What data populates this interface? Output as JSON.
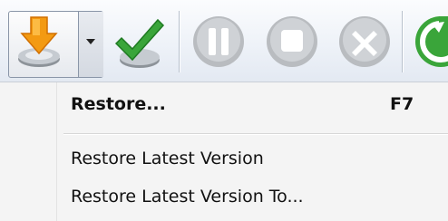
{
  "toolbar": {
    "buttons": [
      {
        "name": "restore",
        "icon": "restore-download-icon",
        "has_dropdown": true
      },
      {
        "name": "verify",
        "icon": "checkmark-icon"
      },
      {
        "name": "pause",
        "icon": "pause-icon"
      },
      {
        "name": "stop",
        "icon": "stop-icon"
      },
      {
        "name": "cancel",
        "icon": "cancel-x-icon"
      },
      {
        "name": "refresh",
        "icon": "refresh-icon"
      }
    ],
    "colors": {
      "orange": "#f39a12",
      "green": "#3aa53a",
      "disabled_gray": "#b9bcc0"
    }
  },
  "menu": {
    "items": [
      {
        "label": "Restore...",
        "shortcut": "F7",
        "bold": true
      },
      {
        "label": "Restore Latest Version"
      },
      {
        "label": "Restore Latest Version To..."
      }
    ]
  }
}
